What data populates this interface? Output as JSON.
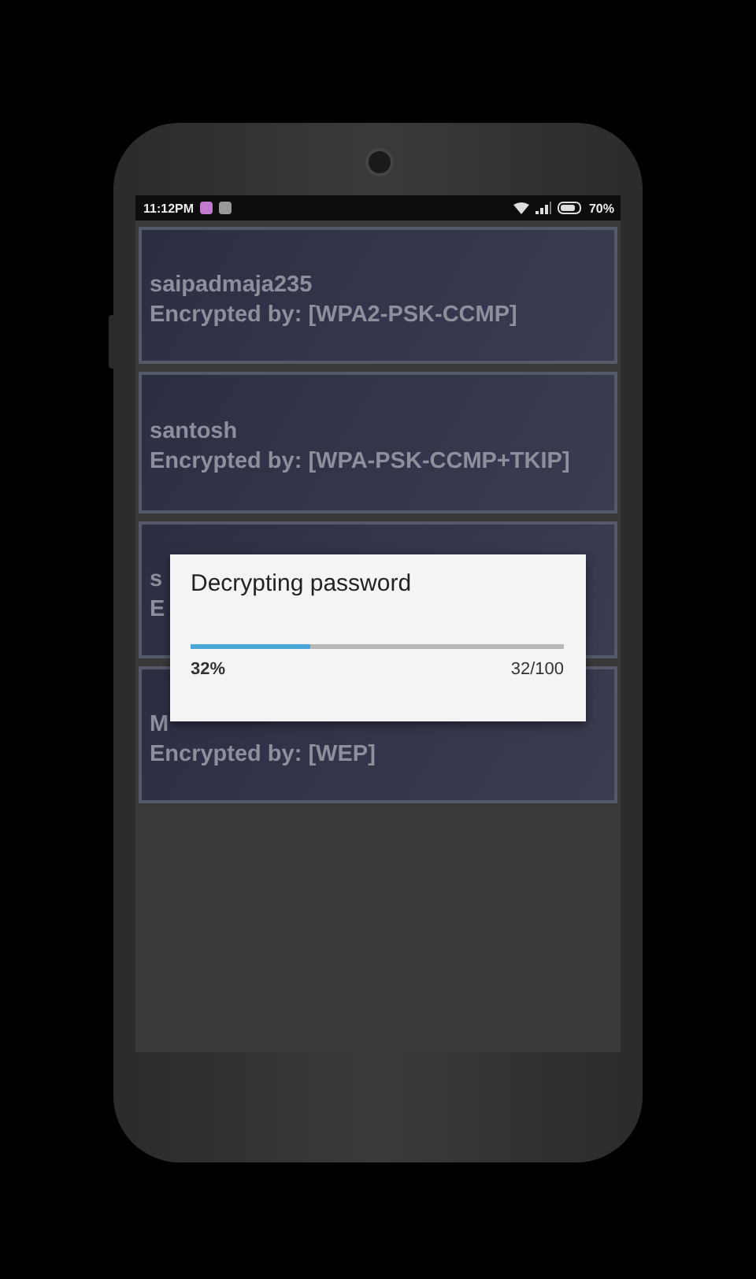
{
  "status_bar": {
    "time": "11:12PM",
    "battery": "70%"
  },
  "networks": [
    {
      "name": "saipadmaja235",
      "encryption": "Encrypted by: [WPA2-PSK-CCMP]"
    },
    {
      "name": "santosh",
      "encryption": "Encrypted by: [WPA-PSK-CCMP+TKIP]"
    },
    {
      "name": "s",
      "encryption": "E"
    },
    {
      "name": "M",
      "encryption": "Encrypted by: [WEP]"
    }
  ],
  "dialog": {
    "title": "Decrypting password",
    "level": 0.32,
    "percent": "32%",
    "count": "32/100"
  }
}
